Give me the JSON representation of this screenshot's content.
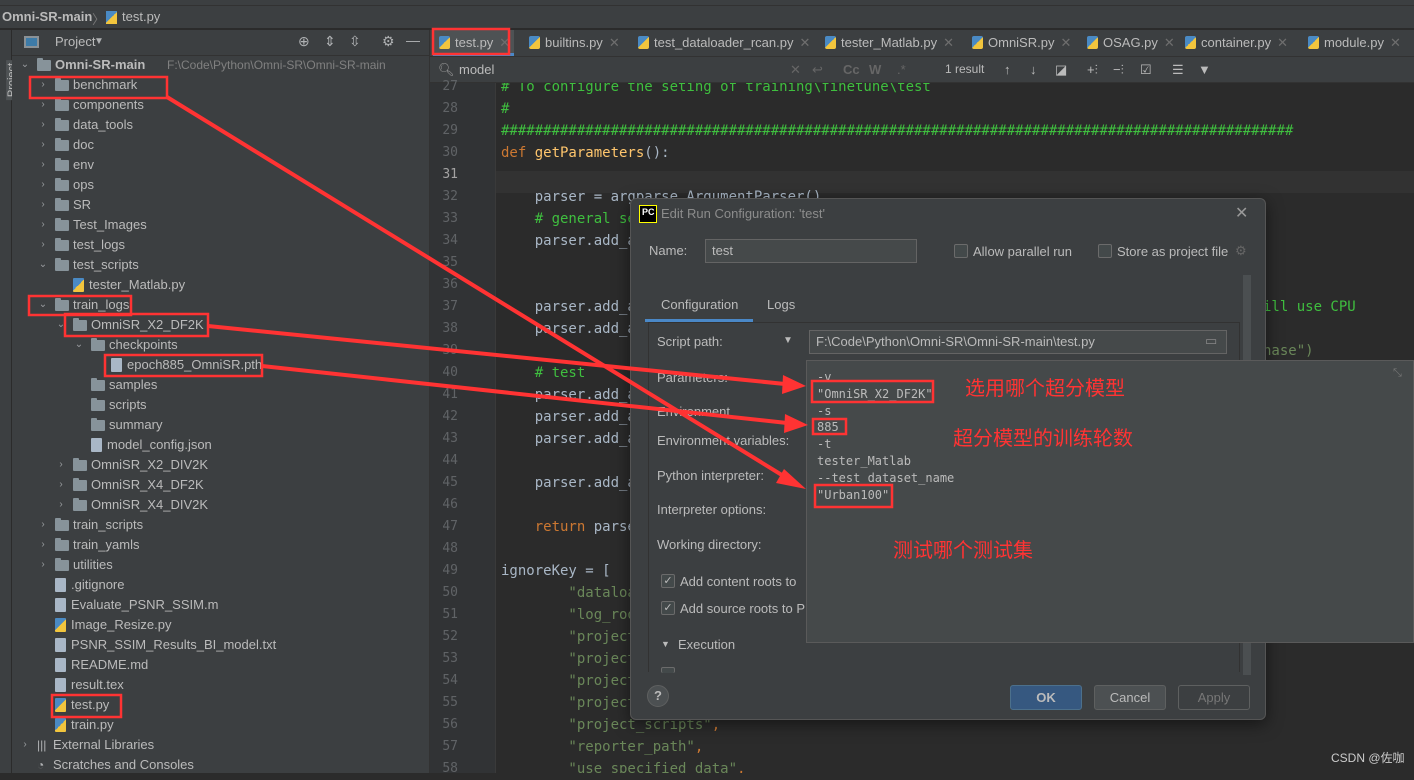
{
  "breadcrumb": {
    "project": "Omni-SR-main",
    "file": "test.py"
  },
  "left_stripe": {
    "label": "Project"
  },
  "project_panel": {
    "view_label": "Project",
    "root_path": "F:\\Code\\Python\\Omni-SR\\Omni-SR-main",
    "tree": [
      {
        "label": "Omni-SR-main",
        "level": 0,
        "type": "folder",
        "expanded": true
      },
      {
        "label": "benchmark",
        "level": 1,
        "type": "folder",
        "expanded": false
      },
      {
        "label": "components",
        "level": 1,
        "type": "folder",
        "expanded": false
      },
      {
        "label": "data_tools",
        "level": 1,
        "type": "folder",
        "expanded": false
      },
      {
        "label": "doc",
        "level": 1,
        "type": "folder",
        "expanded": false
      },
      {
        "label": "env",
        "level": 1,
        "type": "folder",
        "expanded": false
      },
      {
        "label": "ops",
        "level": 1,
        "type": "folder",
        "expanded": false
      },
      {
        "label": "SR",
        "level": 1,
        "type": "folder",
        "expanded": false
      },
      {
        "label": "Test_Images",
        "level": 1,
        "type": "folder",
        "expanded": false
      },
      {
        "label": "test_logs",
        "level": 1,
        "type": "folder",
        "expanded": false
      },
      {
        "label": "test_scripts",
        "level": 1,
        "type": "folder",
        "expanded": true
      },
      {
        "label": "tester_Matlab.py",
        "level": 2,
        "type": "py"
      },
      {
        "label": "train_logs",
        "level": 1,
        "type": "folder",
        "expanded": true
      },
      {
        "label": "OmniSR_X2_DF2K",
        "level": 2,
        "type": "folder",
        "expanded": true
      },
      {
        "label": "checkpoints",
        "level": 3,
        "type": "folder",
        "expanded": true
      },
      {
        "label": "epoch885_OmniSR.pth",
        "level": 4,
        "type": "file"
      },
      {
        "label": "samples",
        "level": 3,
        "type": "folder",
        "leaf": true
      },
      {
        "label": "scripts",
        "level": 3,
        "type": "folder",
        "leaf": true
      },
      {
        "label": "summary",
        "level": 3,
        "type": "folder",
        "leaf": true
      },
      {
        "label": "model_config.json",
        "level": 3,
        "type": "file"
      },
      {
        "label": "OmniSR_X2_DIV2K",
        "level": 2,
        "type": "folder",
        "expanded": false
      },
      {
        "label": "OmniSR_X4_DF2K",
        "level": 2,
        "type": "folder",
        "expanded": false
      },
      {
        "label": "OmniSR_X4_DIV2K",
        "level": 2,
        "type": "folder",
        "expanded": false
      },
      {
        "label": "train_scripts",
        "level": 1,
        "type": "folder",
        "expanded": false
      },
      {
        "label": "train_yamls",
        "level": 1,
        "type": "folder",
        "expanded": false
      },
      {
        "label": "utilities",
        "level": 1,
        "type": "folder",
        "expanded": false
      },
      {
        "label": ".gitignore",
        "level": 1,
        "type": "file"
      },
      {
        "label": "Evaluate_PSNR_SSIM.m",
        "level": 1,
        "type": "file"
      },
      {
        "label": "Image_Resize.py",
        "level": 1,
        "type": "py"
      },
      {
        "label": "PSNR_SSIM_Results_BI_model.txt",
        "level": 1,
        "type": "file"
      },
      {
        "label": "README.md",
        "level": 1,
        "type": "file"
      },
      {
        "label": "result.tex",
        "level": 1,
        "type": "file"
      },
      {
        "label": "test.py",
        "level": 1,
        "type": "py"
      },
      {
        "label": "train.py",
        "level": 1,
        "type": "py"
      },
      {
        "label": "External Libraries",
        "level": 0,
        "type": "lib",
        "expanded": false
      },
      {
        "label": "Scratches and Consoles",
        "level": 0,
        "type": "scratch",
        "leaf": true
      }
    ]
  },
  "editor_tabs": [
    {
      "label": "test.py",
      "active": true
    },
    {
      "label": "builtins.py"
    },
    {
      "label": "test_dataloader_rcan.py"
    },
    {
      "label": "tester_Matlab.py"
    },
    {
      "label": "OmniSR.py"
    },
    {
      "label": "OSAG.py"
    },
    {
      "label": "container.py"
    },
    {
      "label": "module.py"
    }
  ],
  "search": {
    "query": "model",
    "result_count": "1 result",
    "match_case": "Cc",
    "words": "W",
    "regex": ".*"
  },
  "code": {
    "current_line": 31,
    "lines": [
      {
        "n": 27,
        "seg": [
          [
            "# To configure the seting of training\\finetune\\test",
            "comment"
          ]
        ]
      },
      {
        "n": 28,
        "seg": [
          [
            "#",
            "comment"
          ]
        ]
      },
      {
        "n": 29,
        "seg": [
          [
            "##############################################################################################",
            "comment"
          ]
        ]
      },
      {
        "n": 30,
        "seg": [
          [
            "def ",
            "kw"
          ],
          [
            "getParameters",
            "fn"
          ],
          [
            "():",
            "plain"
          ]
        ]
      },
      {
        "n": 31,
        "seg": []
      },
      {
        "n": 32,
        "seg": [
          [
            "    parser = argparse.ArgumentParser()",
            "plain"
          ]
        ]
      },
      {
        "n": 33,
        "seg": [
          [
            "    # general se",
            "comment"
          ]
        ]
      },
      {
        "n": 34,
        "seg": [
          [
            "    parser.add_a",
            "plain"
          ]
        ]
      },
      {
        "n": 35,
        "seg": []
      },
      {
        "n": 36,
        "seg": []
      },
      {
        "n": 37,
        "seg": [
          [
            "    parser.add_a",
            "plain"
          ]
        ]
      },
      {
        "n": 38,
        "seg": [
          [
            "    parser.add_a",
            "plain"
          ]
        ]
      },
      {
        "n": 39,
        "seg": []
      },
      {
        "n": 40,
        "seg": [
          [
            "    # test",
            "comment"
          ]
        ]
      },
      {
        "n": 41,
        "seg": [
          [
            "    parser.add_a",
            "plain"
          ]
        ]
      },
      {
        "n": 42,
        "seg": [
          [
            "    parser.add_a",
            "plain"
          ]
        ]
      },
      {
        "n": 43,
        "seg": [
          [
            "    parser.add_a",
            "plain"
          ]
        ]
      },
      {
        "n": 44,
        "seg": []
      },
      {
        "n": 45,
        "seg": [
          [
            "    parser.add_a",
            "plain"
          ]
        ]
      },
      {
        "n": 46,
        "seg": []
      },
      {
        "n": 47,
        "seg": [
          [
            "    return ",
            "kw"
          ],
          [
            "parser",
            "plain"
          ]
        ]
      },
      {
        "n": 48,
        "seg": []
      },
      {
        "n": 49,
        "seg": [
          [
            "ignoreKey = [",
            "plain"
          ]
        ]
      },
      {
        "n": 50,
        "seg": [
          [
            "        \"dataloa",
            "str"
          ]
        ]
      },
      {
        "n": 51,
        "seg": [
          [
            "        \"log_roo",
            "str"
          ]
        ]
      },
      {
        "n": 52,
        "seg": [
          [
            "        \"project_",
            "str"
          ]
        ]
      },
      {
        "n": 53,
        "seg": [
          [
            "        \"project_",
            "str"
          ]
        ]
      },
      {
        "n": 54,
        "seg": [
          [
            "        \"project_",
            "str"
          ]
        ]
      },
      {
        "n": 55,
        "seg": [
          [
            "        \"project_",
            "str"
          ]
        ]
      },
      {
        "n": 56,
        "seg": [
          [
            "        \"project_scripts\"",
            "str"
          ],
          [
            ",",
            "kw"
          ]
        ]
      },
      {
        "n": 57,
        "seg": [
          [
            "        \"reporter_path\"",
            "str"
          ],
          [
            ",",
            "kw"
          ]
        ]
      },
      {
        "n": 58,
        "seg": [
          [
            "        \"use_specified_data\"",
            "str"
          ],
          [
            ",",
            "kw"
          ]
        ]
      }
    ],
    "right_fragments": {
      "line37": "ill use CPU",
      "line39": "nase\")"
    }
  },
  "dialog": {
    "title": "Edit Run Configuration: 'test'",
    "name_label": "Name:",
    "name_value": "test",
    "allow_parallel": "Allow parallel run",
    "store_project": "Store as project file",
    "tabs": [
      "Configuration",
      "Logs"
    ],
    "script_path_label": "Script path:",
    "script_path": "F:\\Code\\Python\\Omni-SR\\Omni-SR-main\\test.py",
    "parameters_label": "Parameters:",
    "environment_label": "Environment",
    "env_vars_label": "Environment variables:",
    "interpreter_label": "Python interpreter:",
    "interp_options_label": "Interpreter options:",
    "working_dir_label": "Working directory:",
    "content_roots": "Add content roots to",
    "source_roots": "Add source roots to P",
    "execution_label": "Execution",
    "ok": "OK",
    "cancel": "Cancel",
    "apply": "Apply",
    "help": "?"
  },
  "params_popup": {
    "lines": [
      "-v",
      "\"OmniSR_X2_DF2K\"",
      "-s",
      "885",
      "-t",
      "tester_Matlab",
      "--test_dataset_name",
      "\"Urban100\""
    ]
  },
  "annotations": {
    "model": "选用哪个超分模型",
    "epochs": "超分模型的训练轮数",
    "dataset": "测试哪个测试集",
    "color": "#ff3333"
  },
  "watermark": "CSDN @佐咖"
}
